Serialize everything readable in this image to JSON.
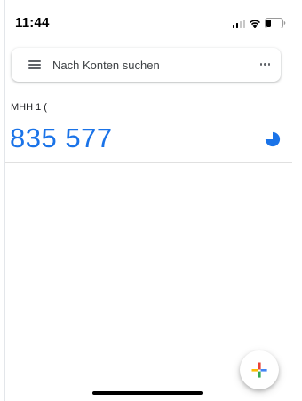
{
  "status_bar": {
    "time": "11:44",
    "icons": [
      "signal-icon",
      "wifi-icon",
      "battery-icon"
    ]
  },
  "search": {
    "menu_icon": "menu-icon",
    "placeholder": "Nach Konten suchen",
    "more_icon": "more-horizontal-icon"
  },
  "accounts": [
    {
      "name": "MHH 1 (",
      "code": "835 577",
      "timer_icon": "countdown-timer-icon",
      "timer_remaining": 0.75
    }
  ],
  "fab": {
    "icon": "add-icon"
  },
  "colors": {
    "code": "#1a73e8",
    "timer": "#1a73e8",
    "plus_red": "#ea4335",
    "plus_blue": "#4285f4",
    "plus_yellow": "#fbbc04",
    "plus_green": "#34a853"
  }
}
